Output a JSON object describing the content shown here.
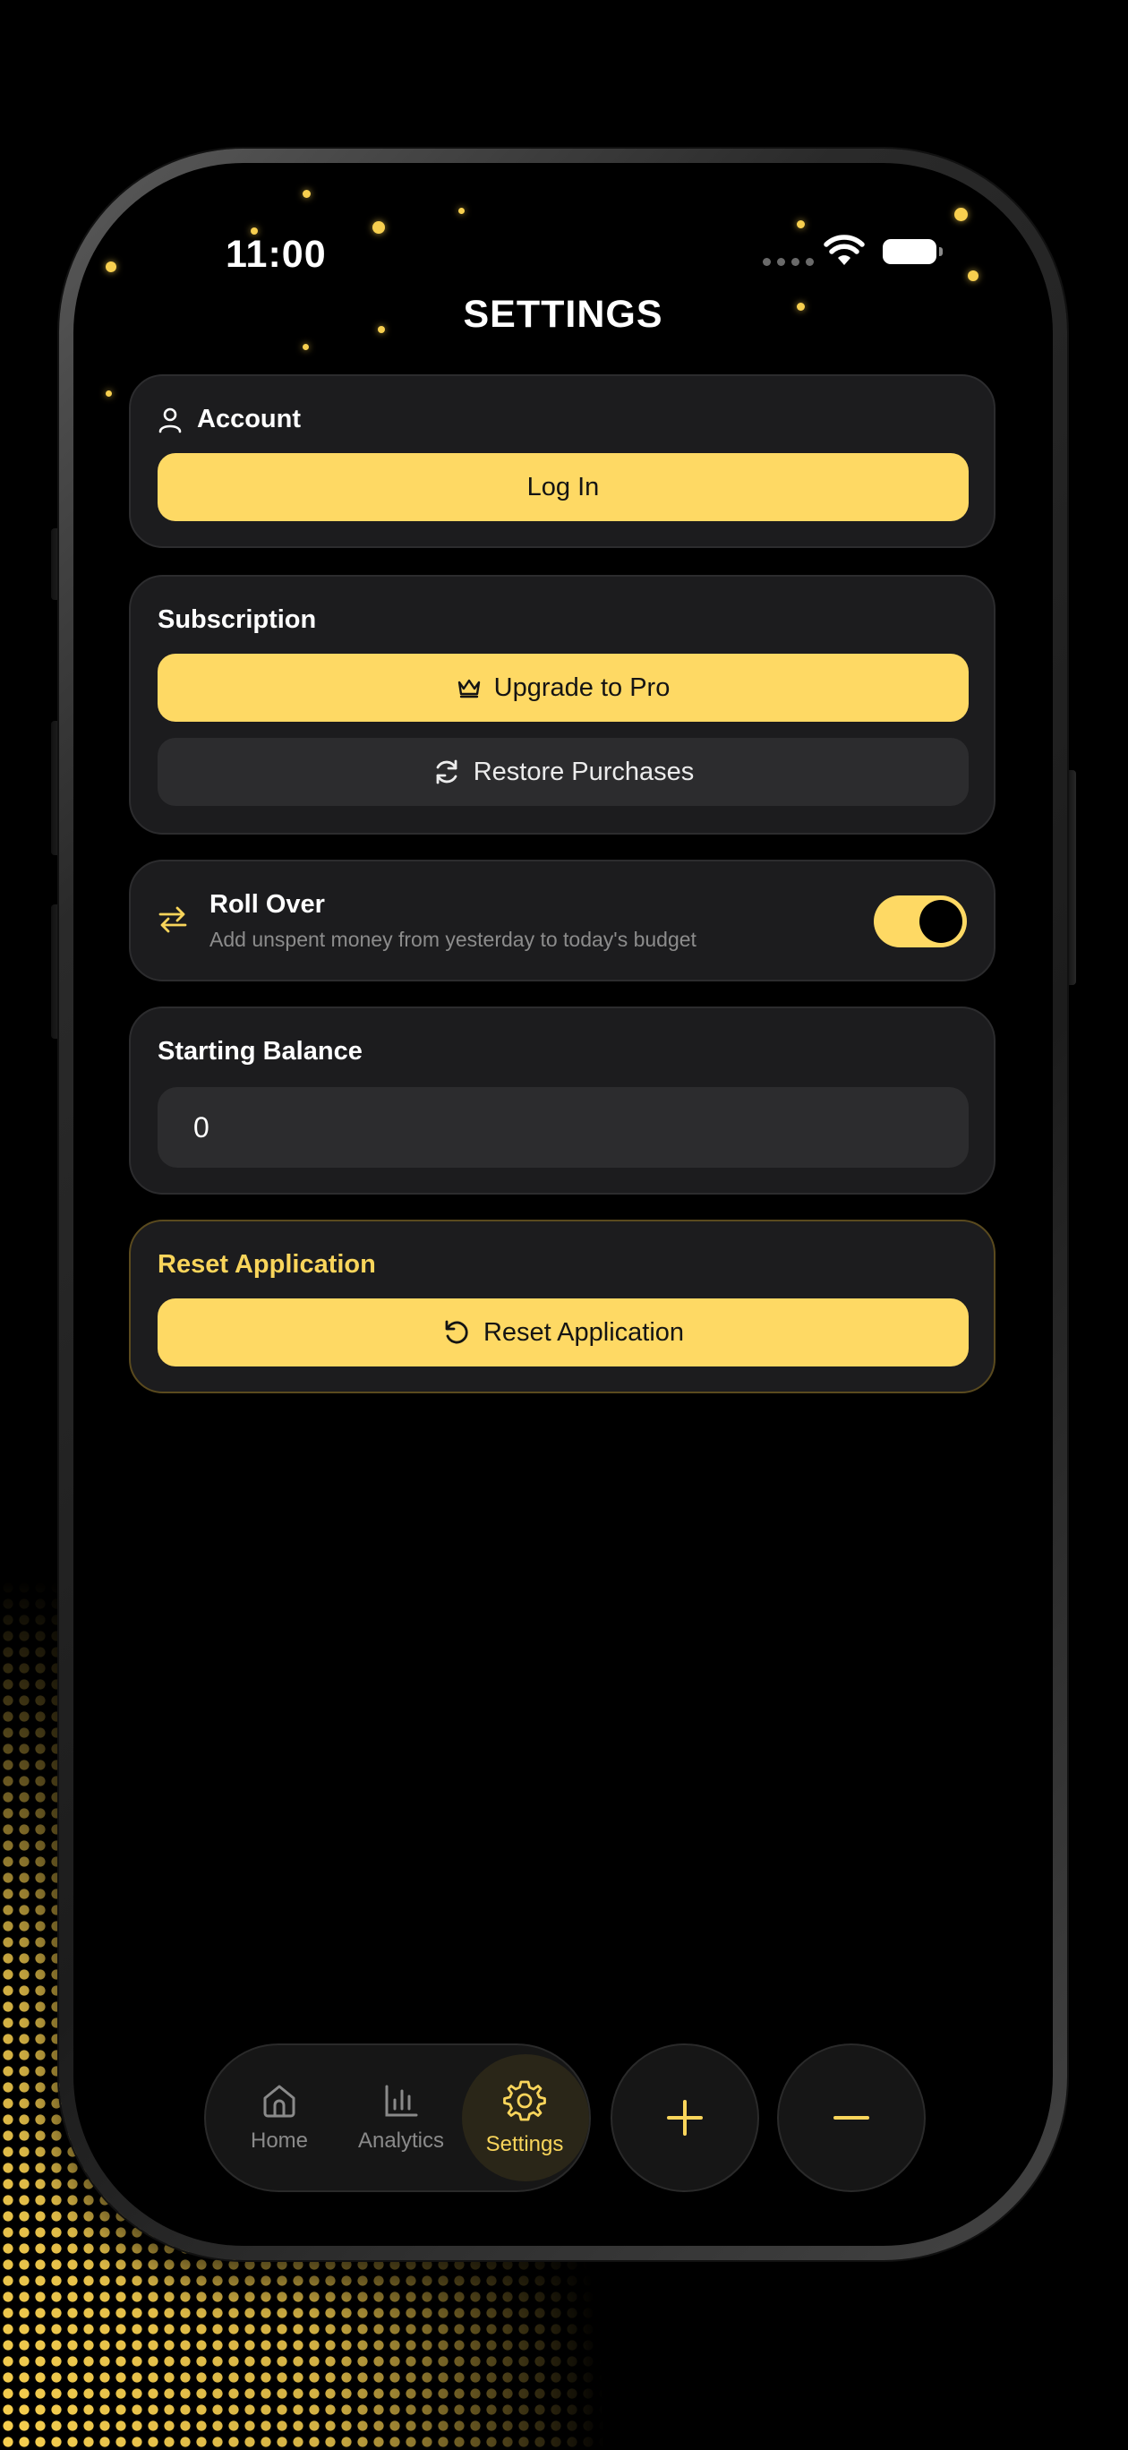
{
  "status_bar": {
    "time": "11:00"
  },
  "header": {
    "title": "SETTINGS"
  },
  "account": {
    "heading": "Account",
    "login_label": "Log In"
  },
  "subscription": {
    "heading": "Subscription",
    "upgrade_label": "Upgrade to Pro",
    "restore_label": "Restore Purchases"
  },
  "rollover": {
    "title": "Roll Over",
    "description": "Add unspent money from yesterday to today's budget",
    "enabled": true
  },
  "starting_balance": {
    "heading": "Starting Balance",
    "value": "0"
  },
  "reset": {
    "heading": "Reset Application",
    "button_label": "Reset Application"
  },
  "tab_bar": {
    "tabs": [
      {
        "label": "Home",
        "icon": "home-icon"
      },
      {
        "label": "Analytics",
        "icon": "chart-icon"
      },
      {
        "label": "Settings",
        "icon": "gear-icon",
        "active": true
      }
    ],
    "add_icon": "plus-icon",
    "subtract_icon": "minus-icon"
  },
  "colors": {
    "accent": "#fed964",
    "background": "#000000",
    "card": "#1c1c1e",
    "field": "#2c2c2e"
  }
}
